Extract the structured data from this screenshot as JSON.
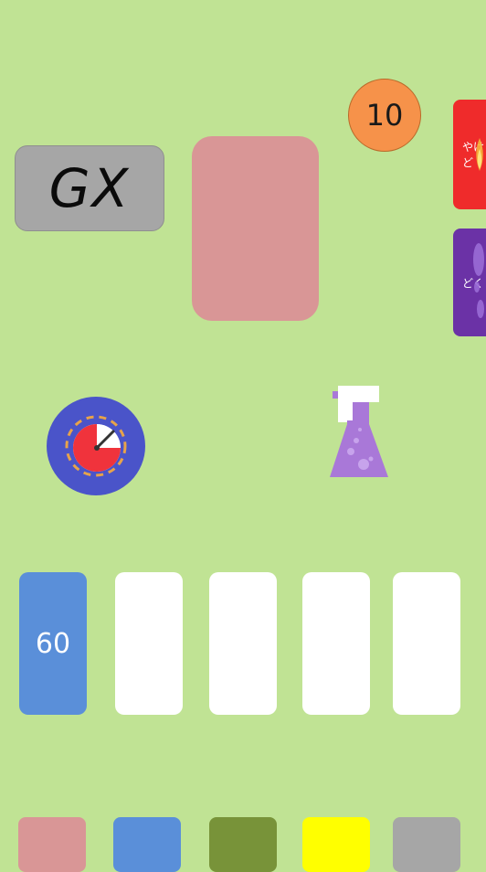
{
  "gx_card": {
    "label": "GX"
  },
  "coin": {
    "value": "10"
  },
  "side_cards": [
    {
      "label": "やけど",
      "color": "#ef2b2b"
    },
    {
      "label": "どく",
      "color": "#6b32a6"
    }
  ],
  "hand_slots": [
    {
      "value": "60",
      "color": "#5a8fd9"
    },
    {
      "value": "",
      "color": "#ffffff"
    },
    {
      "value": "",
      "color": "#ffffff"
    },
    {
      "value": "",
      "color": "#ffffff"
    },
    {
      "value": "",
      "color": "#ffffff"
    }
  ],
  "swatches": [
    "#d99696",
    "#5a8fd9",
    "#789339",
    "#ffff00",
    "#a6a6a6"
  ],
  "colors": {
    "background": "#c0e394",
    "pink_card": "#d99696",
    "coin": "#f6924a",
    "timer_ring": "#4a54c9",
    "timer_fill": "#f0333c",
    "potion": "#a978d8"
  },
  "icons": [
    "timer-icon",
    "potion-flask-icon"
  ]
}
